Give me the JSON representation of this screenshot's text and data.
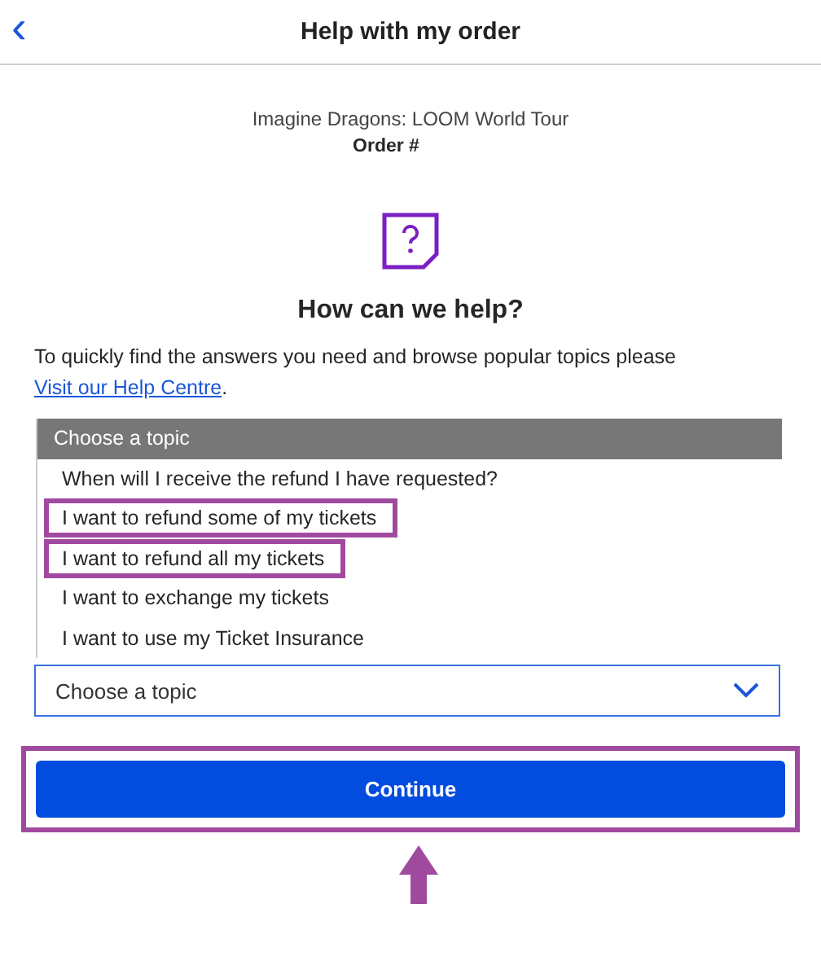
{
  "header": {
    "title": "Help with my order",
    "back": "‹"
  },
  "event": {
    "name": "Imagine Dragons: LOOM World Tour",
    "order": "Order #"
  },
  "heading": "How can we help?",
  "intro": {
    "text": "To quickly find the answers you need and browse popular topics please",
    "link": "Visit our Help Centre",
    "after": "."
  },
  "dropdown": {
    "options": [
      {
        "label": "Choose a topic",
        "selected": true,
        "outlined": false
      },
      {
        "label": "When will I receive the refund I have requested?",
        "selected": false,
        "outlined": false
      },
      {
        "label": "I want to refund some of my tickets",
        "selected": false,
        "outlined": true
      },
      {
        "label": "I want to refund all my tickets",
        "selected": false,
        "outlined": true
      },
      {
        "label": "I want to exchange my tickets",
        "selected": false,
        "outlined": false
      },
      {
        "label": "I want to use my Ticket Insurance",
        "selected": false,
        "outlined": false
      }
    ],
    "value": "Choose a topic"
  },
  "button": {
    "label": "Continue",
    "outlined": true
  },
  "pointer_arrow": true
}
